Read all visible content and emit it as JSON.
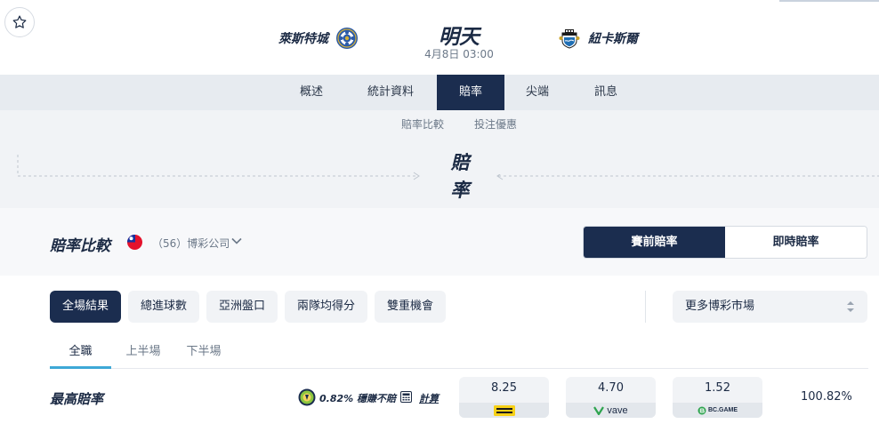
{
  "match": {
    "home_team": "萊斯特城",
    "away_team": "紐卡斯爾",
    "day": "明天",
    "datetime": "4月8日 03:00"
  },
  "nav": {
    "items": [
      {
        "label": "概述"
      },
      {
        "label": "統計資料"
      },
      {
        "label": "賠率",
        "active": true
      },
      {
        "label": "尖端"
      },
      {
        "label": "訊息"
      }
    ]
  },
  "subnav": {
    "items": [
      {
        "label": "賠率比較"
      },
      {
        "label": "投注優惠"
      }
    ]
  },
  "section": {
    "title_line1": "賠",
    "title_line2": "率"
  },
  "comparison": {
    "title": "賠率比較",
    "bookmaker_count": "（56）博彩公司",
    "toggle": {
      "prematch": "賽前賠率",
      "live": "即時賠率"
    }
  },
  "markets": {
    "chips": [
      {
        "label": "全場結果",
        "active": true
      },
      {
        "label": "總進球數"
      },
      {
        "label": "亞洲盤口"
      },
      {
        "label": "兩隊均得分"
      },
      {
        "label": "雙重機會"
      }
    ],
    "more": "更多博彩市場"
  },
  "periods": [
    {
      "label": "全職",
      "active": true
    },
    {
      "label": "上半場"
    },
    {
      "label": "下半場"
    }
  ],
  "best_odds": {
    "title": "最高賠率",
    "arb_text": "0.82% 穩賺不賠",
    "calc_label": "計算",
    "cells": [
      {
        "value": "8.25",
        "bookmaker": "Interwetten"
      },
      {
        "value": "4.70",
        "bookmaker": "vave"
      },
      {
        "value": "1.52",
        "bookmaker": "BC.GAME"
      }
    ],
    "payout": "100.82%"
  },
  "colors": {
    "primary": "#1b2d4f",
    "accent": "#3ea8d6",
    "nav_bg": "#e7ebf0",
    "chip_bg": "#f1f3f6",
    "interwetten_yellow": "#f7d117",
    "vave_green": "#2ea44f"
  }
}
